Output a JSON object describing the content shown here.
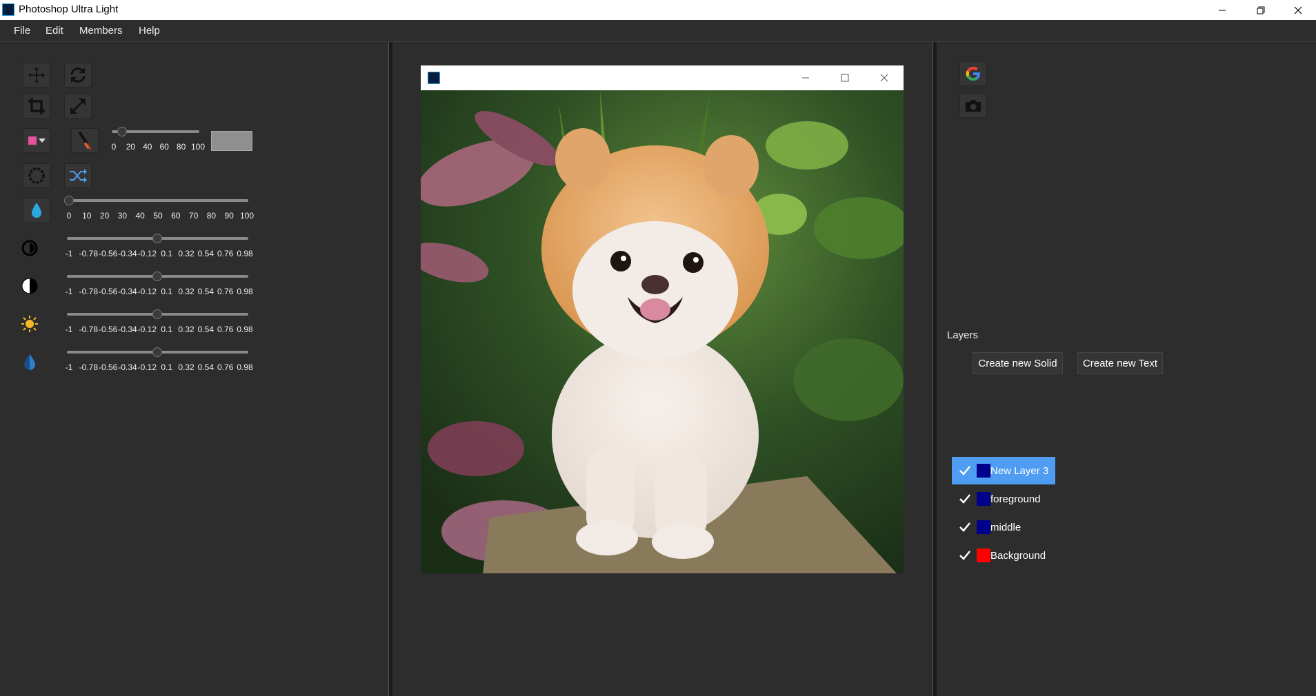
{
  "window": {
    "title": "Photoshop Ultra Light"
  },
  "menu": [
    "File",
    "Edit",
    "Members",
    "Help"
  ],
  "tools": {
    "row1": [
      "move-icon",
      "rotate-icon"
    ],
    "row2": [
      "crop-icon",
      "resize-icon"
    ],
    "row3": [
      "color-picker-icon",
      "brush-icon"
    ],
    "row4": [
      "swirl-icon",
      "shuffle-icon"
    ],
    "adjustments": [
      "drop-icon",
      "contrast-icon",
      "half-circle-icon",
      "sun-icon",
      "blue-drop-icon"
    ]
  },
  "colors": {
    "accent": "#4f9df2",
    "primary_color": "#e8519b",
    "preview": "#8f8f8f",
    "layer_blue": "#00008b",
    "layer_red": "#ff0000"
  },
  "brush_slider": {
    "ticks": [
      "0",
      "20",
      "40",
      "60",
      "80",
      "100"
    ],
    "value": 10
  },
  "opacity_slider": {
    "ticks": [
      "0",
      "10",
      "20",
      "30",
      "40",
      "50",
      "60",
      "70",
      "80",
      "90",
      "100"
    ],
    "value": 0
  },
  "adjust_sliders": [
    {
      "ticks": [
        "-1",
        "-0.78",
        "-0.56",
        "-0.34",
        "-0.12",
        "0.1",
        "0.32",
        "0.54",
        "0.76",
        "0.98"
      ],
      "value": 0
    },
    {
      "ticks": [
        "-1",
        "-0.78",
        "-0.56",
        "-0.34",
        "-0.12",
        "0.1",
        "0.32",
        "0.54",
        "0.76",
        "0.98"
      ],
      "value": 0
    },
    {
      "ticks": [
        "-1",
        "-0.78",
        "-0.56",
        "-0.34",
        "-0.12",
        "0.1",
        "0.32",
        "0.54",
        "0.76",
        "0.98"
      ],
      "value": 0
    },
    {
      "ticks": [
        "-1",
        "-0.78",
        "-0.56",
        "-0.34",
        "-0.12",
        "0.1",
        "0.32",
        "0.54",
        "0.76",
        "0.98"
      ],
      "value": 0
    }
  ],
  "right": {
    "top_icons": [
      "google-icon",
      "camera-icon"
    ],
    "layers_title": "Layers",
    "create_solid": "Create new Solid",
    "create_text": "Create new Text",
    "layers": [
      {
        "name": "New Layer 3",
        "checked": true,
        "color": "#00008b",
        "selected": true
      },
      {
        "name": "foreground",
        "checked": true,
        "color": "#00008b",
        "selected": false
      },
      {
        "name": "middle",
        "checked": true,
        "color": "#00008b",
        "selected": false
      },
      {
        "name": "Background",
        "checked": true,
        "color": "#ff0000",
        "selected": false
      }
    ]
  }
}
